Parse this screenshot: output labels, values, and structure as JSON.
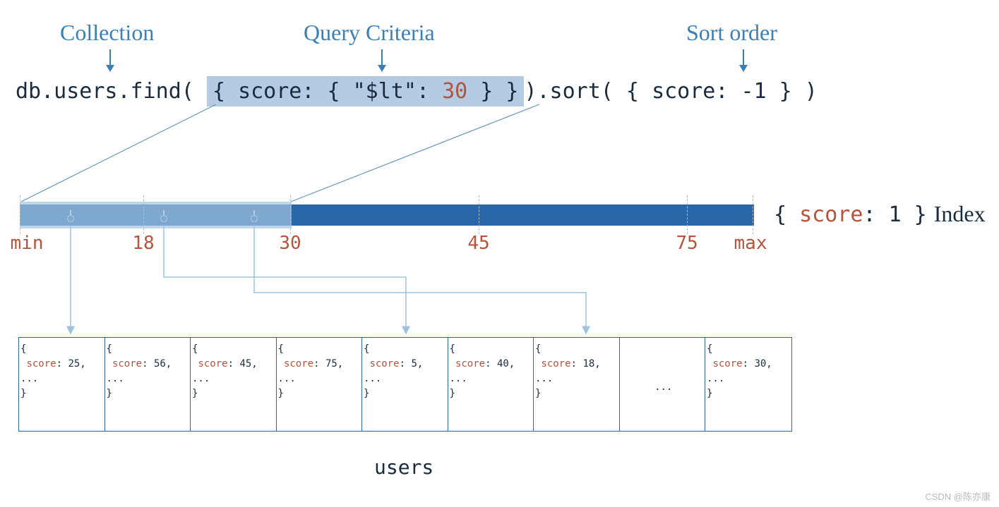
{
  "labels": {
    "collection": "Collection",
    "criteria": "Query Criteria",
    "sort": "Sort order",
    "index_word": "Index",
    "collection_name": "users",
    "watermark": "CSDN @陈亦康"
  },
  "query": {
    "prefix": "db.users.find( ",
    "criteria_open": "{ ",
    "criteria_key": "score",
    "criteria_mid": ": { ",
    "criteria_op": "\"$lt\"",
    "criteria_colon": ": ",
    "criteria_val": "30",
    "criteria_close": " } } ",
    "mid": ").sort( { ",
    "sort_key": "score",
    "sort_colon": ": ",
    "sort_val": "-1",
    "sort_close": " } )"
  },
  "index_def": {
    "open": "{ ",
    "key": "score",
    "colon": ": ",
    "val": "1",
    "close": " }"
  },
  "ticks": {
    "min": "min",
    "t18": "18",
    "t30": "30",
    "t45": "45",
    "t75": "75",
    "max": "max"
  },
  "docs": [
    {
      "score": "25"
    },
    {
      "score": "56"
    },
    {
      "score": "45"
    },
    {
      "score": "75"
    },
    {
      "score": "5"
    },
    {
      "score": "40"
    },
    {
      "score": "18"
    },
    {
      "empty": true
    },
    {
      "score": "30"
    }
  ],
  "doc_template": {
    "open": "{",
    "prefix": " score: ",
    "suffix": ",",
    "dots": "...",
    "close": "}",
    "ellipsis": "..."
  }
}
